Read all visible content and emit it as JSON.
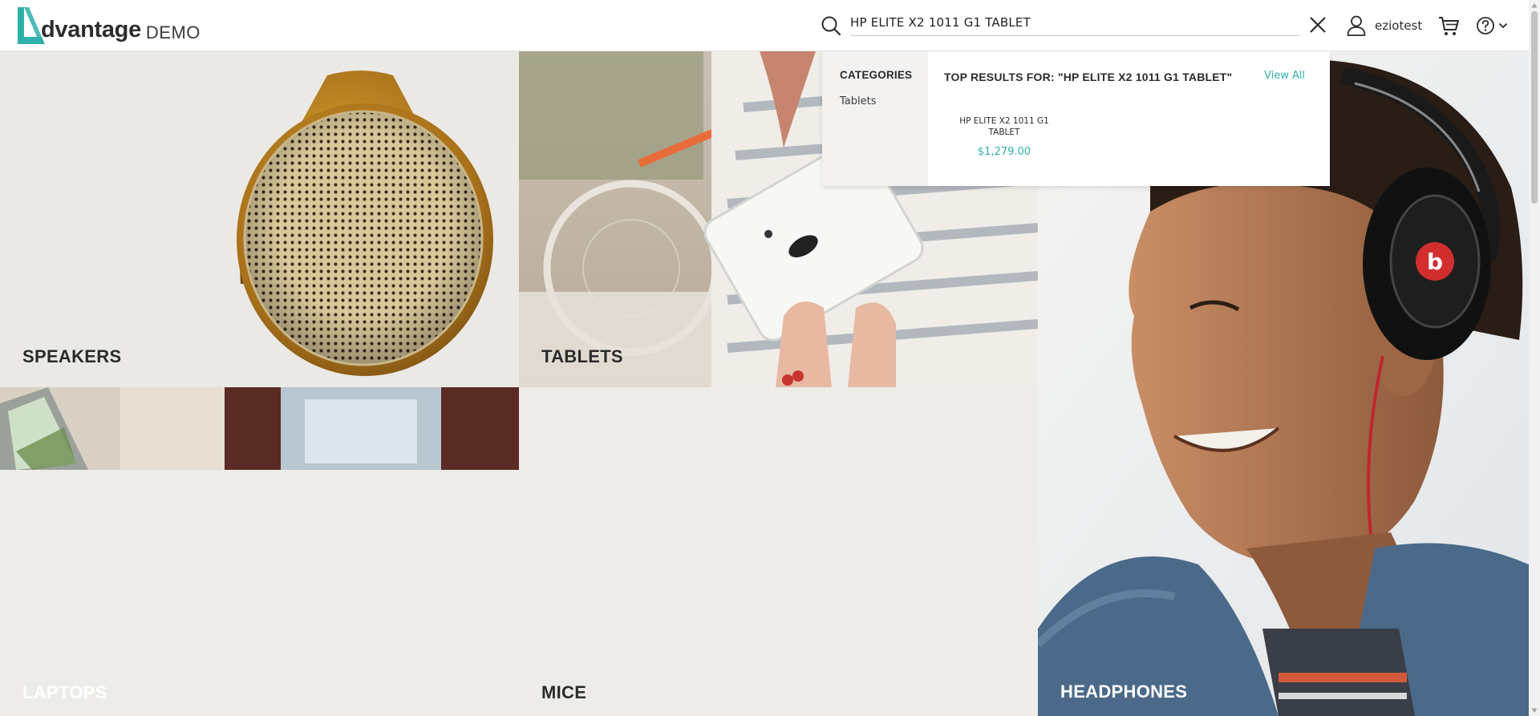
{
  "header": {
    "logo_word": "dvantage",
    "logo_suffix": "DEMO",
    "search": {
      "value": "HP ELITE X2 1011 G1 TABLET",
      "placeholder": ""
    },
    "user_name": "eziotest"
  },
  "tiles": {
    "speakers": "SPEAKERS",
    "tablets": "TABLETS",
    "laptops": "LAPTOPS",
    "mice": "MICE",
    "headphones": "HEADPHONES"
  },
  "dropdown": {
    "categories_title": "CATEGORIES",
    "categories": [
      "Tablets"
    ],
    "results_title": "TOP RESULTS FOR: \"HP ELITE X2 1011 G1 TABLET\"",
    "view_all": "View All",
    "products": [
      {
        "name": "HP ELITE X2 1011 G1 TABLET",
        "price": "$1,279.00"
      }
    ]
  },
  "colors": {
    "brand_teal": "#2fb0a9",
    "text_dark": "#2b2b2b"
  },
  "icons": [
    "logo-mark-icon",
    "search-icon",
    "close-icon",
    "user-icon",
    "cart-icon",
    "help-icon",
    "chevron-down-icon"
  ]
}
